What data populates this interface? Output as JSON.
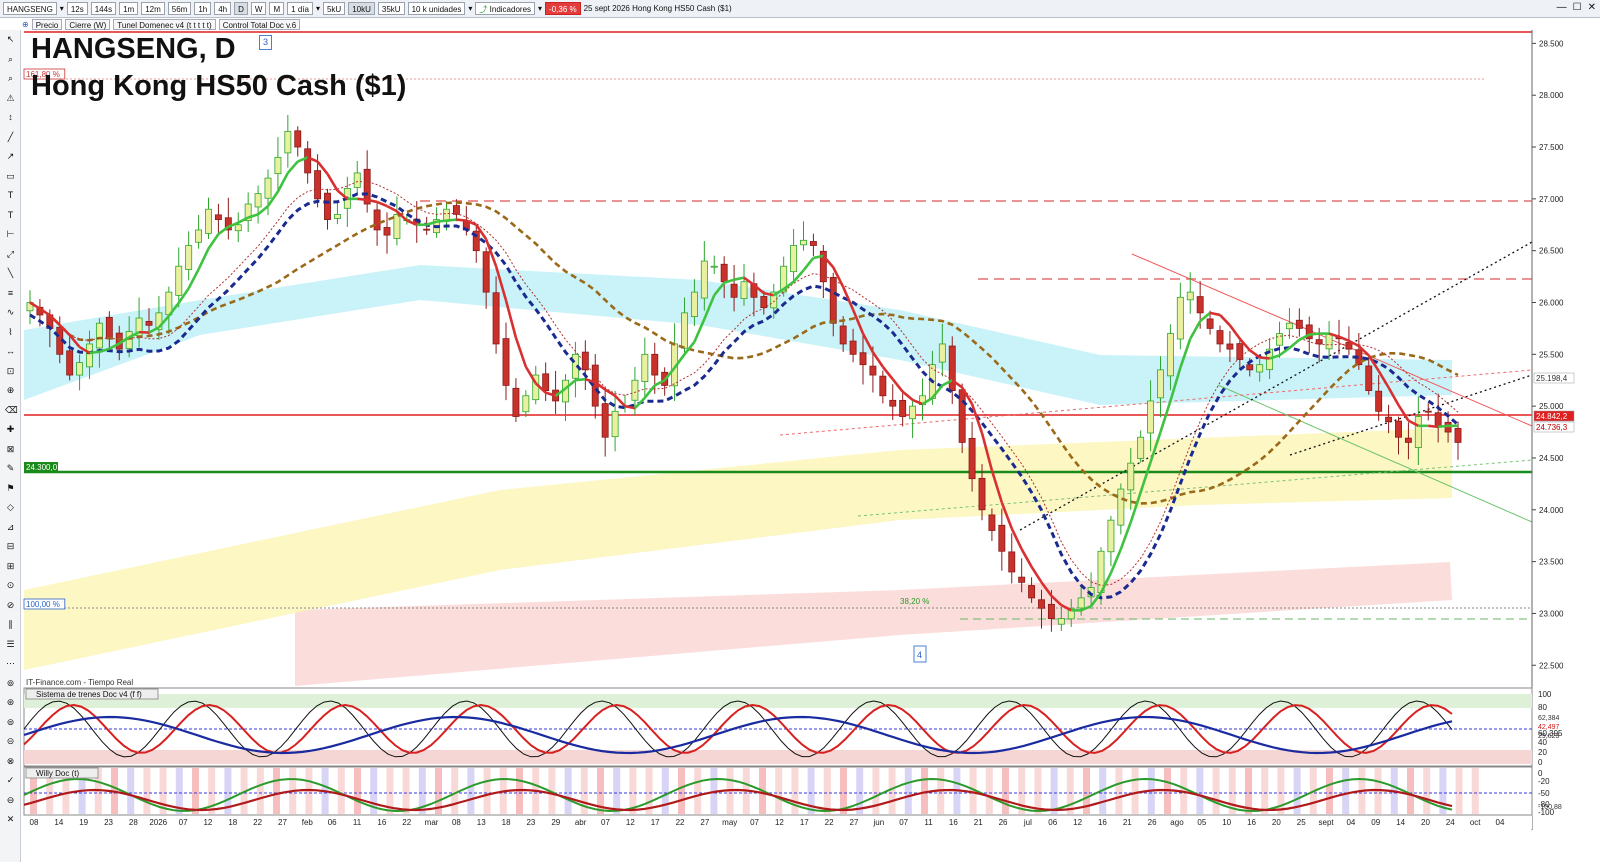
{
  "toolbar": {
    "symbol": "HANGSENG",
    "timeframes": [
      "12s",
      "144s",
      "1m",
      "12m",
      "56m",
      "1h",
      "4h",
      "D",
      "W",
      "M"
    ],
    "ticks": [
      "5kU",
      "10kU",
      "35kU"
    ],
    "units": "10 k unidades",
    "period": "1 día",
    "indicators": "Indicadores",
    "change": "-0,36 %",
    "info": "25 sept 2026  Hong Kong HS50 Cash ($1)"
  },
  "subbar": {
    "items": [
      "Precio",
      "Cierre (W)",
      "Tunel Domenec v4 (t t t t t)",
      "Control Total Doc v.6"
    ]
  },
  "chart": {
    "title": "HANGSENG, D",
    "subtitle": "Hong Kong HS50 Cash ($1)",
    "badge_top": "3",
    "badge_bottom": "4",
    "source": "IT-Finance.com - Tiempo Real",
    "fib_labels": {
      "top": "161,80 %",
      "hundred": "100,00 %",
      "fib38": "38,20 %"
    },
    "level_label": "24.300,0",
    "price_labels": [
      "25.198,4",
      "24.842,2",
      "24.736,3"
    ]
  },
  "chart_data": {
    "type": "candlestick",
    "price_axis": [
      "28.500",
      "28.000",
      "27.500",
      "27.000",
      "26.500",
      "26.000",
      "25.500",
      "25.000",
      "24.500",
      "24.000",
      "23.500",
      "23.000",
      "22.500"
    ],
    "ylim": [
      22300,
      28600
    ],
    "date_labels": [
      "08",
      "14",
      "19",
      "23",
      "28",
      "2026",
      "07",
      "12",
      "18",
      "22",
      "27",
      "feb",
      "06",
      "11",
      "16",
      "22",
      "mar",
      "08",
      "13",
      "18",
      "23",
      "29",
      "abr",
      "07",
      "12",
      "17",
      "22",
      "27",
      "may",
      "07",
      "12",
      "17",
      "22",
      "27",
      "jun",
      "07",
      "11",
      "16",
      "21",
      "26",
      "jul",
      "06",
      "12",
      "16",
      "21",
      "26",
      "ago",
      "05",
      "10",
      "16",
      "20",
      "25",
      "sept",
      "04",
      "09",
      "14",
      "20",
      "24",
      "oct",
      "04"
    ],
    "closes": [
      26000,
      25880,
      25750,
      25500,
      25300,
      25420,
      25600,
      25800,
      25650,
      25550,
      25720,
      25850,
      25780,
      25900,
      26100,
      26350,
      26550,
      26700,
      26900,
      26800,
      26700,
      26750,
      26950,
      27050,
      27200,
      27400,
      27650,
      27500,
      27250,
      27000,
      26800,
      26850,
      27100,
      27250,
      26950,
      26700,
      26650,
      26850,
      26800,
      26750,
      26700,
      26800,
      26900,
      26850,
      26700,
      26500,
      26100,
      25600,
      25200,
      24900,
      25100,
      25300,
      25150,
      25050,
      25250,
      25500,
      25350,
      25000,
      24700,
      24950,
      25000,
      25250,
      25500,
      25300,
      25200,
      25600,
      25900,
      26100,
      26400,
      26350,
      26200,
      26050,
      26200,
      26050,
      25950,
      26100,
      26350,
      26550,
      26600,
      26550,
      26200,
      25800,
      25600,
      25500,
      25400,
      25300,
      25100,
      25000,
      24900,
      25000,
      25100,
      25400,
      25600,
      25150,
      24650,
      24300,
      24000,
      23800,
      23600,
      23400,
      23300,
      23150,
      23050,
      22950,
      22950,
      23050,
      23150,
      23250,
      23600,
      23900,
      24200,
      24450,
      24700,
      25050,
      25350,
      25700,
      26050,
      26100,
      25900,
      25750,
      25600,
      25550,
      25450,
      25350,
      25400,
      25550,
      25700,
      25800,
      25750,
      25650,
      25600,
      25700,
      25650,
      25550,
      25400,
      25150,
      24950,
      24850,
      24700,
      24650,
      24900,
      24950,
      24800,
      24750,
      24650
    ],
    "series": [
      {
        "name": "Precio",
        "values": []
      }
    ],
    "xlabel": "",
    "ylabel": ""
  },
  "osc1": {
    "title": "Sistema de trenes Doc v4 (f f)",
    "axis": [
      "100",
      "80",
      "60,395",
      "40",
      "20",
      "0"
    ],
    "labels": [
      "62,384",
      "42,497",
      "29,623"
    ]
  },
  "osc2": {
    "title": "Willy Doc (t)",
    "axis": [
      "0",
      "-20",
      "-50",
      "-80",
      "-100"
    ],
    "labels": [
      "-100,88"
    ]
  },
  "colors": {
    "up": "#3fc23f",
    "down": "#d83030",
    "red_line": "#e02020",
    "green_line": "#1a8a1a",
    "navy": "#1a2a8f",
    "brown": "#9a6a1a",
    "cyan_band": "#bdf0f7",
    "yellow_band": "#fbf6b8",
    "pink_band": "#f9d2cf"
  }
}
